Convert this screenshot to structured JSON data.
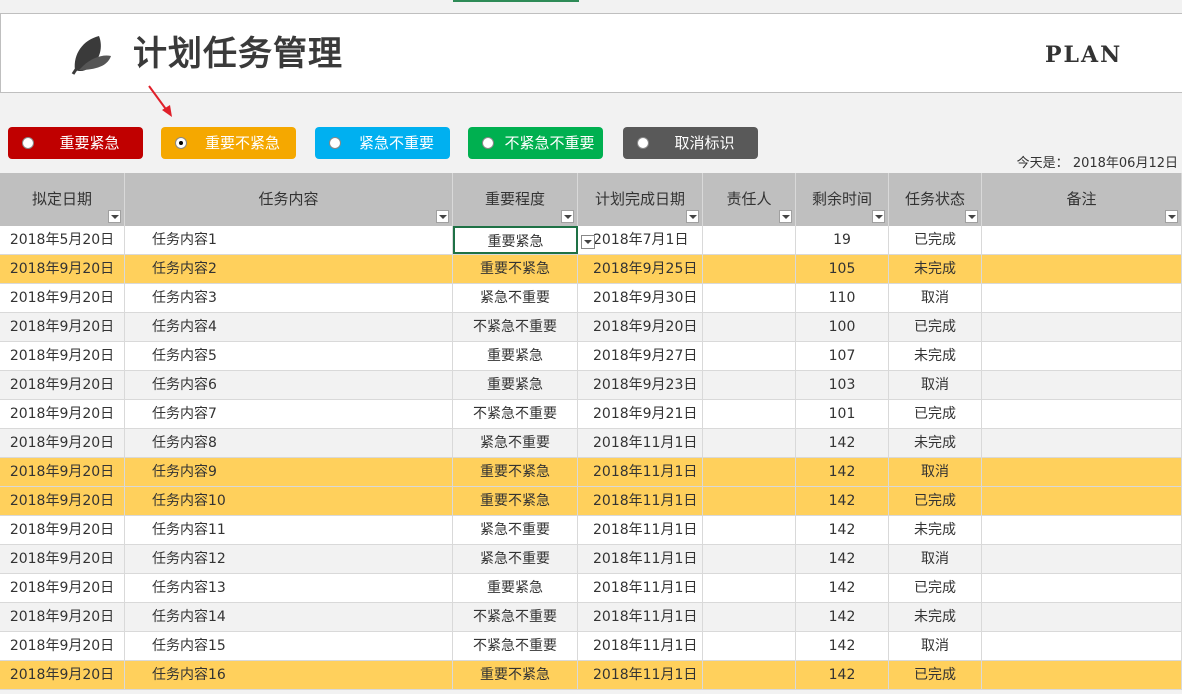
{
  "header": {
    "title": "计划任务管理",
    "plan_text": "PLAN",
    "leaf_icon": "leaf-icon"
  },
  "legend": [
    {
      "label": "重要紧急",
      "color": "#c00000",
      "checked": false
    },
    {
      "label": "重要不紧急",
      "color": "#f5a800",
      "checked": true
    },
    {
      "label": "紧急不重要",
      "color": "#00b0f0",
      "checked": false
    },
    {
      "label": "不紧急不重要",
      "color": "#00b050",
      "checked": false
    },
    {
      "label": "取消标识",
      "color": "#595959",
      "checked": false
    }
  ],
  "today": {
    "label": "今天是：",
    "value": "2018年06月12日"
  },
  "table": {
    "columns": [
      "拟定日期",
      "任务内容",
      "重要程度",
      "计划完成日期",
      "责任人",
      "剩余时间",
      "任务状态",
      "备注"
    ],
    "rows": [
      {
        "date": "2018年5月20日",
        "task": "任务内容1",
        "level": "重要紧急",
        "due": "2018年7月1日",
        "owner": "",
        "remain": "19",
        "status": "已完成",
        "note": "",
        "style": "white"
      },
      {
        "date": "2018年9月20日",
        "task": "任务内容2",
        "level": "重要不紧急",
        "due": "2018年9月25日",
        "owner": "",
        "remain": "105",
        "status": "未完成",
        "note": "",
        "style": "orange"
      },
      {
        "date": "2018年9月20日",
        "task": "任务内容3",
        "level": "紧急不重要",
        "due": "2018年9月30日",
        "owner": "",
        "remain": "110",
        "status": "取消",
        "note": "",
        "style": "white"
      },
      {
        "date": "2018年9月20日",
        "task": "任务内容4",
        "level": "不紧急不重要",
        "due": "2018年9月20日",
        "owner": "",
        "remain": "100",
        "status": "已完成",
        "note": "",
        "style": "gray"
      },
      {
        "date": "2018年9月20日",
        "task": "任务内容5",
        "level": "重要紧急",
        "due": "2018年9月27日",
        "owner": "",
        "remain": "107",
        "status": "未完成",
        "note": "",
        "style": "white"
      },
      {
        "date": "2018年9月20日",
        "task": "任务内容6",
        "level": "重要紧急",
        "due": "2018年9月23日",
        "owner": "",
        "remain": "103",
        "status": "取消",
        "note": "",
        "style": "gray"
      },
      {
        "date": "2018年9月20日",
        "task": "任务内容7",
        "level": "不紧急不重要",
        "due": "2018年9月21日",
        "owner": "",
        "remain": "101",
        "status": "已完成",
        "note": "",
        "style": "white"
      },
      {
        "date": "2018年9月20日",
        "task": "任务内容8",
        "level": "紧急不重要",
        "due": "2018年11月1日",
        "owner": "",
        "remain": "142",
        "status": "未完成",
        "note": "",
        "style": "gray"
      },
      {
        "date": "2018年9月20日",
        "task": "任务内容9",
        "level": "重要不紧急",
        "due": "2018年11月1日",
        "owner": "",
        "remain": "142",
        "status": "取消",
        "note": "",
        "style": "orange"
      },
      {
        "date": "2018年9月20日",
        "task": "任务内容10",
        "level": "重要不紧急",
        "due": "2018年11月1日",
        "owner": "",
        "remain": "142",
        "status": "已完成",
        "note": "",
        "style": "orange"
      },
      {
        "date": "2018年9月20日",
        "task": "任务内容11",
        "level": "紧急不重要",
        "due": "2018年11月1日",
        "owner": "",
        "remain": "142",
        "status": "未完成",
        "note": "",
        "style": "white"
      },
      {
        "date": "2018年9月20日",
        "task": "任务内容12",
        "level": "紧急不重要",
        "due": "2018年11月1日",
        "owner": "",
        "remain": "142",
        "status": "取消",
        "note": "",
        "style": "gray"
      },
      {
        "date": "2018年9月20日",
        "task": "任务内容13",
        "level": "重要紧急",
        "due": "2018年11月1日",
        "owner": "",
        "remain": "142",
        "status": "已完成",
        "note": "",
        "style": "white"
      },
      {
        "date": "2018年9月20日",
        "task": "任务内容14",
        "level": "不紧急不重要",
        "due": "2018年11月1日",
        "owner": "",
        "remain": "142",
        "status": "未完成",
        "note": "",
        "style": "gray"
      },
      {
        "date": "2018年9月20日",
        "task": "任务内容15",
        "level": "不紧急不重要",
        "due": "2018年11月1日",
        "owner": "",
        "remain": "142",
        "status": "取消",
        "note": "",
        "style": "white"
      },
      {
        "date": "2018年9月20日",
        "task": "任务内容16",
        "level": "重要不紧急",
        "due": "2018年11月1日",
        "owner": "",
        "remain": "142",
        "status": "已完成",
        "note": "",
        "style": "orange"
      }
    ]
  }
}
